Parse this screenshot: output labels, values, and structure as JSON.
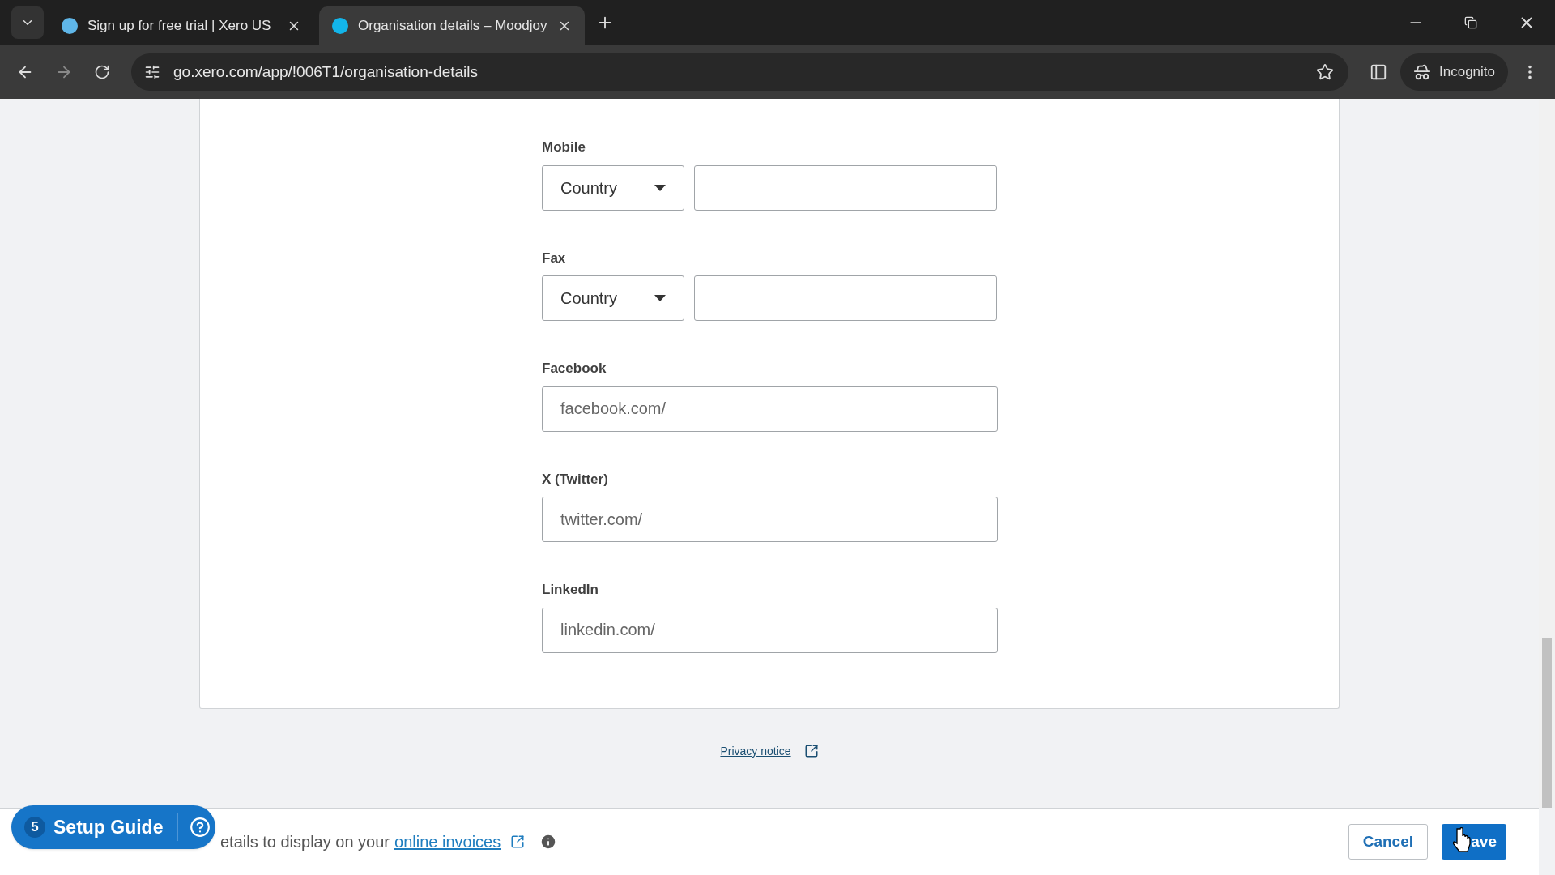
{
  "browser": {
    "tabs": [
      {
        "title": "Sign up for free trial | Xero US",
        "selected": false
      },
      {
        "title": "Organisation details – Moodjoy",
        "selected": true
      }
    ],
    "url": "go.xero.com/app/!006T1/organisation-details",
    "profile": "Incognito"
  },
  "form": {
    "fields": [
      {
        "kind": "phone",
        "label": "Mobile",
        "select": "Country"
      },
      {
        "kind": "phone",
        "label": "Fax",
        "select": "Country"
      },
      {
        "kind": "text",
        "label": "Facebook",
        "placeholder": "facebook.com/"
      },
      {
        "kind": "text",
        "label": "X (Twitter)",
        "placeholder": "twitter.com/"
      },
      {
        "kind": "text",
        "label": "LinkedIn",
        "placeholder": "linkedin.com/"
      }
    ]
  },
  "privacy_link": "Privacy notice",
  "footer": {
    "text": "etails to display on your",
    "link": "online invoices",
    "cancel": "Cancel",
    "save": "ave"
  },
  "setup_guide": {
    "count": "5",
    "label": "Setup Guide"
  }
}
